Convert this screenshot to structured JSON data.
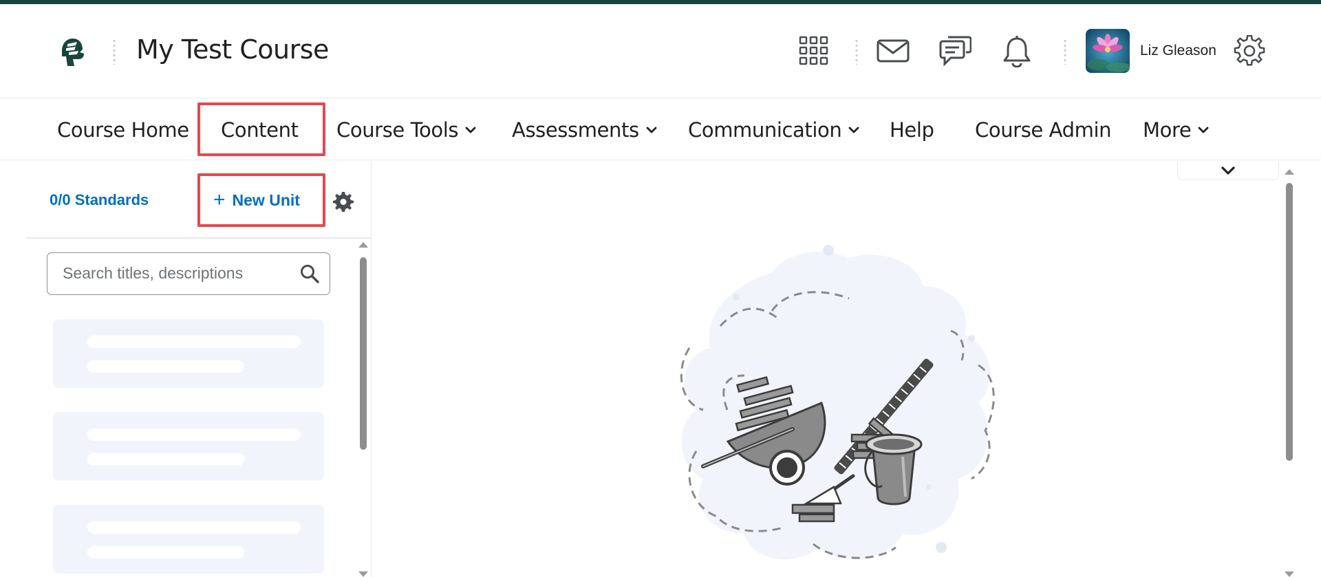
{
  "header": {
    "course_title": "My Test Course",
    "user_name": "Liz Gleason",
    "icons": [
      "spartan-logo-icon",
      "app-grid-icon",
      "mail-icon",
      "chat-icon",
      "bell-icon",
      "gear-icon"
    ]
  },
  "nav": {
    "items": [
      {
        "label": "Course Home",
        "has_dropdown": false
      },
      {
        "label": "Content",
        "has_dropdown": false
      },
      {
        "label": "Course Tools",
        "has_dropdown": true
      },
      {
        "label": "Assessments",
        "has_dropdown": true
      },
      {
        "label": "Communication",
        "has_dropdown": true
      },
      {
        "label": "Help",
        "has_dropdown": false
      },
      {
        "label": "Course Admin",
        "has_dropdown": false
      },
      {
        "label": "More",
        "has_dropdown": true
      }
    ]
  },
  "left_panel": {
    "standards_label": "0/0 Standards",
    "new_unit_label": "New Unit",
    "new_unit_plus": "+",
    "search_placeholder": "Search titles, descriptions"
  },
  "colors": {
    "brand_green": "#18453b",
    "link_blue": "#006fbf",
    "highlight_red": "#e8474c",
    "skeleton_fill": "#f1f5fb"
  }
}
